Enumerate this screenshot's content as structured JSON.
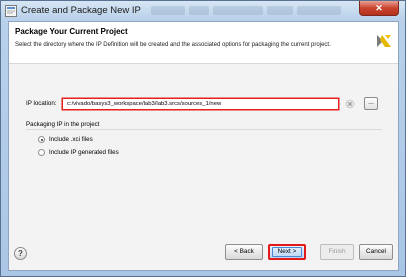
{
  "window": {
    "title": "Create and Package New IP",
    "close_symbol": "✕"
  },
  "header": {
    "title": "Package Your Current Project",
    "description": "Select the directory where the IP Definition will be created and the associated options for packaging the current project.",
    "logo_icon": "vivado-logo-icon"
  },
  "ip_location": {
    "label": "IP location:",
    "value": "c:/vivado/basys3_workspace/lab3/lab3.srcs/sources_1/new",
    "browse_label": "...",
    "clear_icon": "clear-icon"
  },
  "packaging": {
    "section_label": "Packaging IP in the project",
    "options": [
      {
        "label": "Include .xci files",
        "selected": true
      },
      {
        "label": "Include IP generated files",
        "selected": false
      }
    ]
  },
  "footer": {
    "help_symbol": "?",
    "back_label": "< Back",
    "next_label": "Next >",
    "finish_label": "Finish",
    "cancel_label": "Cancel"
  },
  "colors": {
    "highlight": "#e52020",
    "logo": "#e6b800",
    "window_chrome": "#b9d1ea"
  }
}
